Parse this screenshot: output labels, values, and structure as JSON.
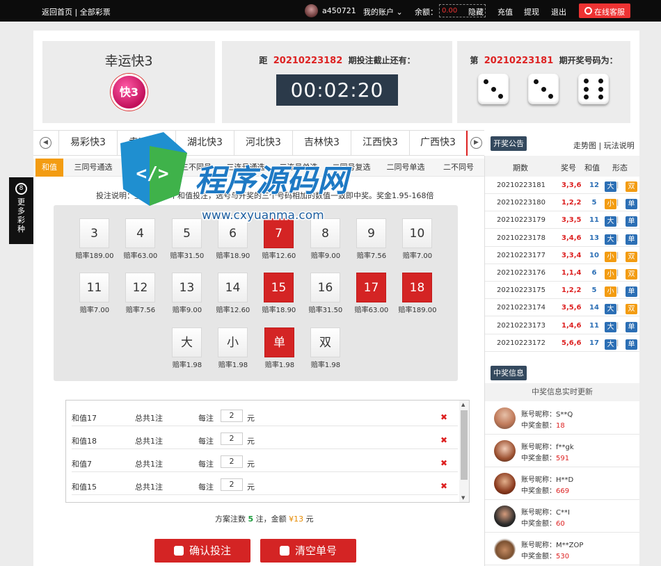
{
  "topbar": {
    "home": "返回首页",
    "sep": "|",
    "all_lottery": "全部彩票",
    "username": "a450721",
    "my_account": "我的账户",
    "balance_label": "余额：",
    "balance_value": "0.00",
    "hide": "隐藏",
    "deposit": "充值",
    "withdraw": "提现",
    "logout": "退出",
    "service": "在线客服"
  },
  "game": {
    "name": "幸运快3",
    "logo_text": "快3",
    "countdown_prefix": "距",
    "countdown_issue": "20210223182",
    "countdown_suffix": "期投注截止还有：",
    "timer": "00:02:20",
    "result_prefix": "第",
    "result_issue": "20210223181",
    "result_suffix": "期开奖号码为：",
    "dice": [
      3,
      3,
      6
    ]
  },
  "game_tabs": [
    "易彩快3",
    "幸运快3",
    "湖北快3",
    "河北快3",
    "吉林快3",
    "江西快3",
    "广西快3"
  ],
  "notice_button": "开奖公告",
  "side_links": {
    "trend": "走势图",
    "sep": "|",
    "rules": "玩法说明"
  },
  "sub_tabs": [
    "和值",
    "三同号通选",
    "三同号单选",
    "三不同号",
    "三连号通选",
    "三连号单选",
    "二同号复选",
    "二同号单选",
    "二不同号"
  ],
  "description": "投注说明：至少选择1个和值投注，选号与开奖的三个号码相加的数值一致即中奖。奖金1.95-168倍",
  "balls": [
    {
      "label": "3",
      "odds": "赔率189.00",
      "selected": false
    },
    {
      "label": "4",
      "odds": "赔率63.00",
      "selected": false
    },
    {
      "label": "5",
      "odds": "赔率31.50",
      "selected": false
    },
    {
      "label": "6",
      "odds": "赔率18.90",
      "selected": false
    },
    {
      "label": "7",
      "odds": "赔率12.60",
      "selected": true
    },
    {
      "label": "8",
      "odds": "赔率9.00",
      "selected": false
    },
    {
      "label": "9",
      "odds": "赔率7.56",
      "selected": false
    },
    {
      "label": "10",
      "odds": "赔率7.00",
      "selected": false
    },
    {
      "label": "11",
      "odds": "赔率7.00",
      "selected": false
    },
    {
      "label": "12",
      "odds": "赔率7.56",
      "selected": false
    },
    {
      "label": "13",
      "odds": "赔率9.00",
      "selected": false
    },
    {
      "label": "14",
      "odds": "赔率12.60",
      "selected": false
    },
    {
      "label": "15",
      "odds": "赔率18.90",
      "selected": true
    },
    {
      "label": "16",
      "odds": "赔率31.50",
      "selected": false
    },
    {
      "label": "17",
      "odds": "赔率63.00",
      "selected": true
    },
    {
      "label": "18",
      "odds": "赔率189.00",
      "selected": true
    },
    {
      "label": "大",
      "odds": "赔率1.98",
      "selected": false
    },
    {
      "label": "小",
      "odds": "赔率1.98",
      "selected": false
    },
    {
      "label": "单",
      "odds": "赔率1.98",
      "selected": true
    },
    {
      "label": "双",
      "odds": "赔率1.98",
      "selected": false
    }
  ],
  "bets": [
    {
      "name": "和值17",
      "total": "总共1注",
      "per": "每注",
      "qty": "2",
      "unit": "元"
    },
    {
      "name": "和值18",
      "total": "总共1注",
      "per": "每注",
      "qty": "2",
      "unit": "元"
    },
    {
      "name": "和值7",
      "total": "总共1注",
      "per": "每注",
      "qty": "2",
      "unit": "元"
    },
    {
      "name": "和值15",
      "total": "总共1注",
      "per": "每注",
      "qty": "2",
      "unit": "元"
    }
  ],
  "summary": {
    "pre": "方案注数",
    "count": "5",
    "mid": "注，金额",
    "amount": "¥13",
    "post": "元"
  },
  "confirm_button": "确认投注",
  "clear_button": "清空单号",
  "draw_header": {
    "issue": "期数",
    "number": "奖号",
    "sum": "和值",
    "shape": "形态"
  },
  "draws": [
    {
      "issue": "20210223181",
      "nums": "3,3,6",
      "sum": "12",
      "size": "大",
      "parity": "双"
    },
    {
      "issue": "20210223180",
      "nums": "1,2,2",
      "sum": "5",
      "size": "小",
      "parity": "单"
    },
    {
      "issue": "20210223179",
      "nums": "3,3,5",
      "sum": "11",
      "size": "大",
      "parity": "单"
    },
    {
      "issue": "20210223178",
      "nums": "3,4,6",
      "sum": "13",
      "size": "大",
      "parity": "单"
    },
    {
      "issue": "20210223177",
      "nums": "3,3,4",
      "sum": "10",
      "size": "小",
      "parity": "双"
    },
    {
      "issue": "20210223176",
      "nums": "1,1,4",
      "sum": "6",
      "size": "小",
      "parity": "双"
    },
    {
      "issue": "20210223175",
      "nums": "1,2,2",
      "sum": "5",
      "size": "小",
      "parity": "单"
    },
    {
      "issue": "20210223174",
      "nums": "3,5,6",
      "sum": "14",
      "size": "大",
      "parity": "双"
    },
    {
      "issue": "20210223173",
      "nums": "1,4,6",
      "sum": "11",
      "size": "大",
      "parity": "单"
    },
    {
      "issue": "20210223172",
      "nums": "5,6,6",
      "sum": "17",
      "size": "大",
      "parity": "单"
    }
  ],
  "win_info_button": "中奖信息",
  "win_info_sub": "中奖信息实时更新",
  "winners": [
    {
      "nick_label": "账号昵称：",
      "nick": "S**Q",
      "amt_label": "中奖金额：",
      "amount": "18"
    },
    {
      "nick_label": "账号昵称：",
      "nick": "f**gk",
      "amt_label": "中奖金额：",
      "amount": "591"
    },
    {
      "nick_label": "账号昵称：",
      "nick": "H**D",
      "amt_label": "中奖金额：",
      "amount": "669"
    },
    {
      "nick_label": "账号昵称：",
      "nick": "C**I",
      "amt_label": "中奖金额：",
      "amount": "60"
    },
    {
      "nick_label": "账号昵称：",
      "nick": "M**ZOP",
      "amt_label": "中奖金额：",
      "amount": "530"
    }
  ],
  "more_lottery": {
    "num": "8",
    "text": "更多彩种"
  },
  "watermark": {
    "cn": "程序源码网",
    "url": "www.cxyuanma.com"
  },
  "colors": {
    "accent_red": "#d42424",
    "orange": "#f39c12",
    "blue": "#2c6fb5",
    "navy": "#34495e"
  }
}
